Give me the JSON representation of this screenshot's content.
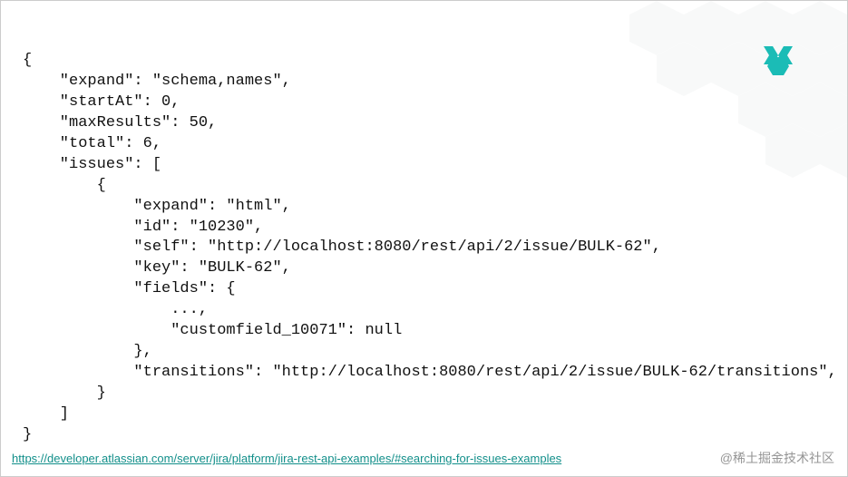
{
  "code_text": "{\n    \"expand\": \"schema,names\",\n    \"startAt\": 0,\n    \"maxResults\": 50,\n    \"total\": 6,\n    \"issues\": [\n        {\n            \"expand\": \"html\",\n            \"id\": \"10230\",\n            \"self\": \"http://localhost:8080/rest/api/2/issue/BULK-62\",\n            \"key\": \"BULK-62\",\n            \"fields\": {\n                ...,\n                \"customfield_10071\": null\n            },\n            \"transitions\": \"http://localhost:8080/rest/api/2/issue/BULK-62/transitions\",\n        }\n    ]\n}",
  "footer": {
    "url": "https://developer.atlassian.com/server/jira/platform/jira-rest-api-examples/#searching-for-issues-examples"
  },
  "watermark": "@稀土掘金技术社区",
  "logo_name": "x-logo-icon",
  "brand_color": "#1bbcb6"
}
